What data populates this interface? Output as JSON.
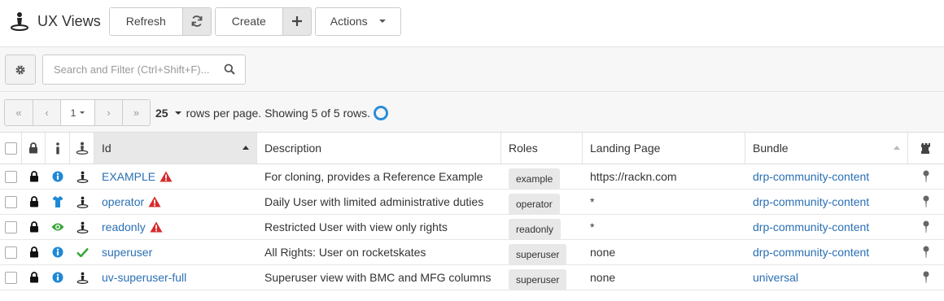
{
  "header": {
    "title": "UX Views",
    "refresh_label": "Refresh",
    "create_label": "Create",
    "actions_label": "Actions"
  },
  "filter": {
    "search_placeholder": "Search and Filter (Ctrl+Shift+F)..."
  },
  "pager": {
    "first": "«",
    "prev": "‹",
    "page": "1",
    "next": "›",
    "last": "»",
    "rows_per_page": "25",
    "rows_text": "rows per page. Showing 5 of 5 rows."
  },
  "table": {
    "columns": {
      "id": "Id",
      "description": "Description",
      "roles": "Roles",
      "landing_page": "Landing Page",
      "bundle": "Bundle"
    },
    "rows": [
      {
        "id": "EXAMPLE",
        "description": "For cloning, provides a Reference Example",
        "role": "example",
        "landing_page": "https://rackn.com",
        "bundle": "drp-community-content",
        "status_icon": "info-circle-icon",
        "warning": true
      },
      {
        "id": "operator",
        "description": "Daily User with limited administrative duties",
        "role": "operator",
        "landing_page": "*",
        "bundle": "drp-community-content",
        "status_icon": "shirt-icon",
        "warning": true
      },
      {
        "id": "readonly",
        "description": "Restricted User with view only rights",
        "role": "readonly",
        "landing_page": "*",
        "bundle": "drp-community-content",
        "status_icon": "eye-icon",
        "warning": true
      },
      {
        "id": "superuser",
        "description": "All Rights: User on rocketskates",
        "role": "superuser",
        "landing_page": "none",
        "bundle": "drp-community-content",
        "status_icon": "info-circle-icon",
        "warning": false
      },
      {
        "id": "uv-superuser-full",
        "description": "Superuser view with BMC and MFG columns",
        "role": "superuser",
        "landing_page": "none",
        "bundle": "universal",
        "status_icon": "info-circle-icon",
        "warning": false
      }
    ]
  },
  "colors": {
    "link": "#2a6fb3",
    "info": "#1e88d6",
    "ok": "#3aa63a",
    "warning": "#d62b2b",
    "spinner": "#2b8dd6"
  }
}
